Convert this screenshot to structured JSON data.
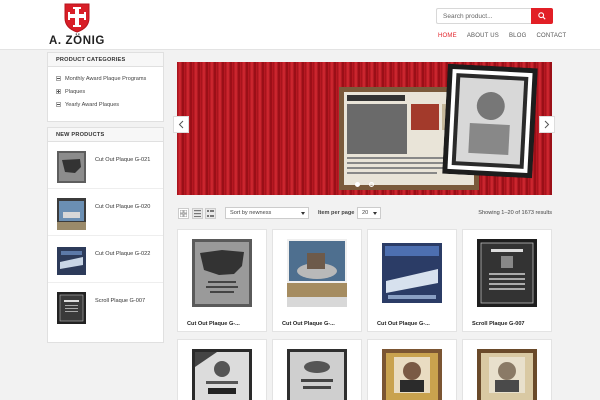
{
  "brand": {
    "name": "A. ZÖNIG"
  },
  "search": {
    "placeholder": "Search product..."
  },
  "nav": [
    {
      "label": "HOME"
    },
    {
      "label": "ABOUT US"
    },
    {
      "label": "BLOG"
    },
    {
      "label": "CONTACT"
    }
  ],
  "categories": {
    "title": "PRODUCT CATEGORIES",
    "items": [
      {
        "label": "Monthly Award Plaque Programs"
      },
      {
        "label": "Plaques"
      },
      {
        "label": "Yearly Award Plaques"
      }
    ]
  },
  "new_products": {
    "title": "NEW PRODUCTS",
    "items": [
      {
        "name": "Cut Out Plaque G-021"
      },
      {
        "name": "Cut Out Plaque G-020"
      },
      {
        "name": "Cut Out Plaque G-022"
      },
      {
        "name": "Scroll Plaque G-007"
      }
    ]
  },
  "toolbar": {
    "sort_value": "Sort by newness",
    "items_per_page_label": "Item per page",
    "items_per_page_value": "20",
    "results": "Showing 1–20 of 1673 results"
  },
  "products": [
    {
      "name": "Cut Out Plaque G-..."
    },
    {
      "name": "Cut Out Plaque G-..."
    },
    {
      "name": "Cut Out Plaque G-..."
    },
    {
      "name": "Scroll Plaque G-007"
    }
  ],
  "colors": {
    "accent": "#e21f26"
  }
}
